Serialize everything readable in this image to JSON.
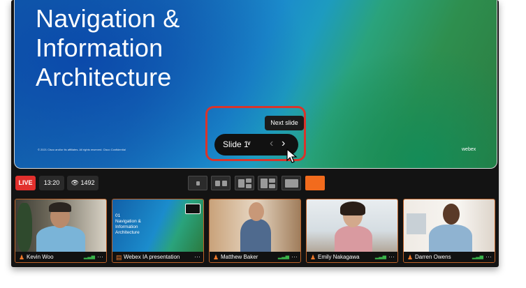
{
  "slide": {
    "title": "Navigation &\nInformation\nArchitecture",
    "footer": "© 2021 Cisco and/or its affiliates. All rights reserved. Cisco Confidential",
    "brand": "webex",
    "control_label": "Slide 1",
    "tooltip": "Next slide"
  },
  "toolbar": {
    "live_label": "LIVE",
    "timer": "13:20",
    "viewer_count": "1492",
    "accent": "#f26b1d"
  },
  "tiles": [
    {
      "name": "Kevin Woo"
    },
    {
      "name": "Webex IA presentation",
      "thumb_text": "01\nNavigation &\nInformation\nArchitecture"
    },
    {
      "name": "Matthew Baker"
    },
    {
      "name": "Emily Nakagawa"
    },
    {
      "name": "Darren Owens"
    }
  ],
  "colors": {
    "live": "#e2302d",
    "highlight": "#d9342b",
    "tile_border": "#c06227",
    "signal": "#39b34a"
  }
}
